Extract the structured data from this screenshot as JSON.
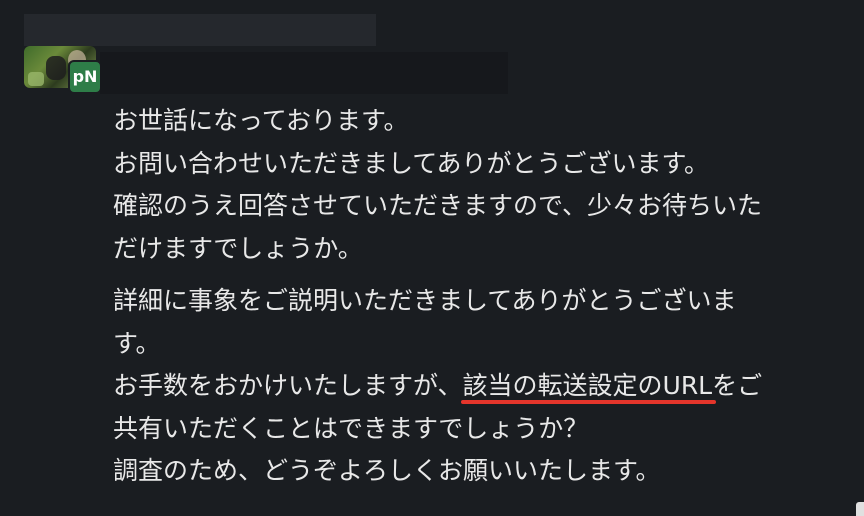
{
  "header": {
    "avatar_badge": "pN"
  },
  "message": {
    "para1": [
      "お世話になっております。",
      "お問い合わせいただきましてありがとうございます。",
      "確認のうえ回答させていただきますので、少々お待ちいた",
      "だけますでしょうか。"
    ],
    "para2": {
      "line1": "詳細に事象をご説明いただきましてありがとうございま",
      "line2": "す。",
      "line3_pre": "お手数をおかけいたしますが、",
      "line3_highlight": "該当の転送設定のURL",
      "line3_post": "をご",
      "line4": "共有いただくことはできますでしょうか？",
      "line5": "調査のため、どうぞよろしくお願いいたします。"
    }
  },
  "colors": {
    "background": "#1a1d21",
    "text": "#e8e8e8",
    "badge": "#2e7d48",
    "highlight_underline": "#e4352b"
  }
}
